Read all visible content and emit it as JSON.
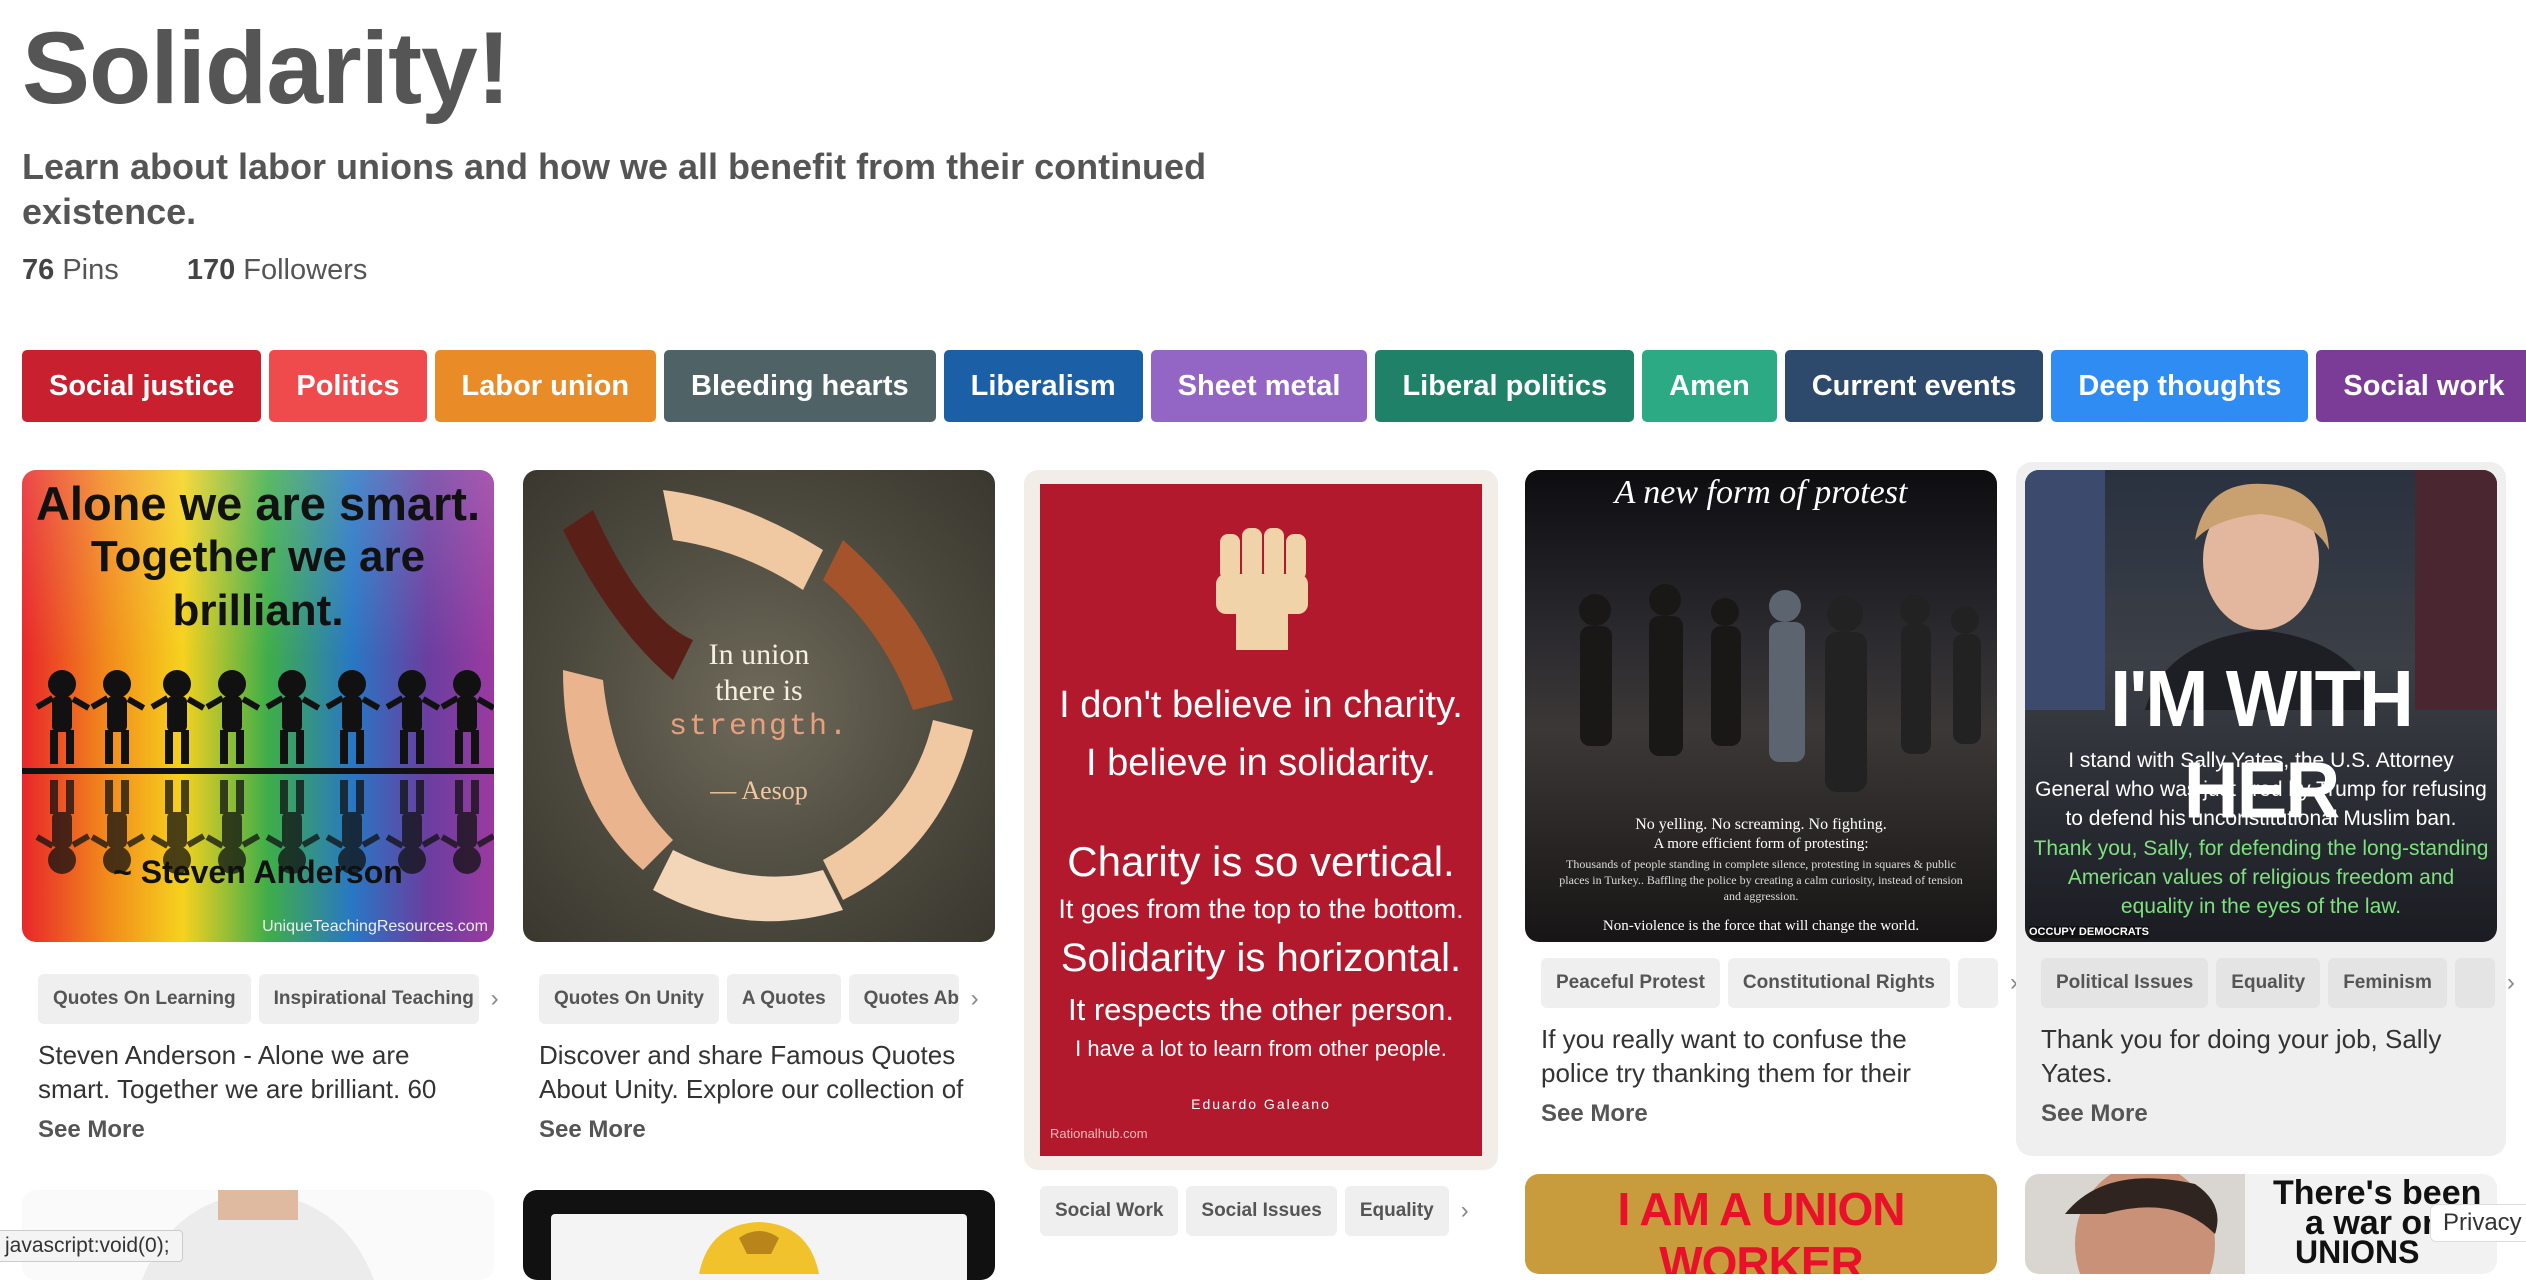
{
  "board": {
    "title": "Solidarity!",
    "description": "Learn about labor unions and how we all benefit from their continued existence.",
    "pins_count": "76",
    "pins_label": "Pins",
    "followers_count": "170",
    "followers_label": "Followers"
  },
  "tags": [
    {
      "label": "Social justice",
      "color": "#c8202e"
    },
    {
      "label": "Politics",
      "color": "#ef4a4c"
    },
    {
      "label": "Labor union",
      "color": "#e98b26"
    },
    {
      "label": "Bleeding hearts",
      "color": "#4f6367"
    },
    {
      "label": "Liberalism",
      "color": "#1b5fa6"
    },
    {
      "label": "Sheet metal",
      "color": "#9365c4"
    },
    {
      "label": "Liberal politics",
      "color": "#1f8168"
    },
    {
      "label": "Amen",
      "color": "#2baa83"
    },
    {
      "label": "Current events",
      "color": "#2d4a6c"
    },
    {
      "label": "Deep thoughts",
      "color": "#2e8cf3"
    },
    {
      "label": "Social work",
      "color": "#7a3c97"
    }
  ],
  "pins": [
    {
      "img_text_1": "Alone we are smart.",
      "img_text_2": "Together we are",
      "img_text_3": "brilliant.",
      "img_text_4": "~ Steven Anderson",
      "img_text_5": "UniqueTeachingResources.com",
      "chips": [
        "Quotes On Learning",
        "Inspirational Teaching"
      ],
      "description": "Steven Anderson - Alone we are smart. Together we are brilliant. 60",
      "see_more": "See More"
    },
    {
      "img_text_1": "In union",
      "img_text_2": "there is",
      "img_text_3": "strength.",
      "img_text_4": "— Aesop",
      "chips": [
        "Quotes On Unity",
        "A Quotes",
        "Quotes About"
      ],
      "description": "Discover and share Famous Quotes About Unity. Explore our collection of",
      "see_more": "See More"
    },
    {
      "img_text_1": "I don't believe in charity.",
      "img_text_2": "I believe in solidarity.",
      "img_text_3": "Charity is so vertical.",
      "img_text_4": "It goes from the top to the bottom.",
      "img_text_5": "Solidarity is horizontal.",
      "img_text_6": "It respects the other person.",
      "img_text_7": "I have a lot to learn from other people.",
      "img_text_8": "Eduardo Galeano",
      "img_text_9": "Rationalhub.com",
      "chips": [
        "Social Work",
        "Social Issues",
        "Equality"
      ]
    },
    {
      "img_text_1": "A new form of protest",
      "img_text_2": "No yelling. No screaming. No fighting.",
      "img_text_3": "A more efficient form of protesting:",
      "img_text_4": "Thousands of people standing in complete silence, protesting in squares & public places in Turkey.. Baffling the police by creating a calm curiosity, instead of tension and aggression.",
      "img_text_5": "Non-violence is the force that will change the world.",
      "chips": [
        "Peaceful Protest",
        "Constitutional Rights"
      ],
      "description": "If you really want to confuse the police try thanking them for their",
      "see_more": "See More"
    },
    {
      "img_text_1": "I'M WITH HER",
      "img_text_2": "I stand with Sally Yates, the U.S. Attorney General who was just fired by Trump for refusing to defend his unconstitutional Muslim ban.",
      "img_text_3": "Thank you, Sally, for defending the long-standing American values of religious freedom and equality in the eyes of the law.",
      "img_text_4": "OCCUPY DEMOCRATS",
      "chips": [
        "Political Issues",
        "Equality",
        "Feminism"
      ],
      "description": "Thank you for doing your job, Sally Yates.",
      "see_more": "See More"
    }
  ],
  "second_row": {
    "union_worker_text": "I AM A UNION WORKER",
    "war_text_1": "There's been",
    "war_text_2": "a war on",
    "war_text_3": "UNIONS"
  },
  "status_bar": "javascript:void(0);",
  "privacy": "Privacy"
}
